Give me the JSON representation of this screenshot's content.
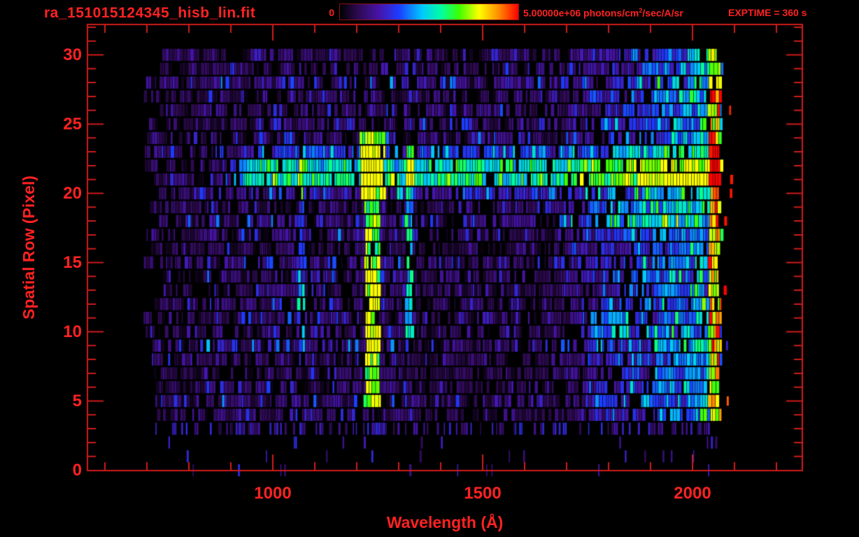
{
  "header": {
    "title": "ra_151015124345_hisb_lin.fit",
    "colorbar": {
      "min_label": "0",
      "max_prefix": "5.00000e+06 photons/cm",
      "max_sup": "2",
      "max_suffix": "/sec/A/sr"
    },
    "exptime": "EXPTIME = 360 s"
  },
  "chart_data": {
    "type": "heatmap",
    "title": "ra_151015124345_hisb_lin.fit",
    "xlabel": "Wavelength (Å)",
    "ylabel": "Spatial Row (Pixel)",
    "x_ticks": [
      1000,
      1500,
      2000
    ],
    "x_minor_step": 100,
    "x_minor_range": [
      600,
      2200
    ],
    "x_range": [
      558,
      2262
    ],
    "y_ticks": [
      0,
      5,
      10,
      15,
      20,
      25,
      30
    ],
    "y_minor_step": 1,
    "y_range": [
      0,
      32.2
    ],
    "colorbar": {
      "min": 0,
      "max": 5000000,
      "max_label": "5.00000e+06",
      "units": "photons/cm^2/sec/A/sr"
    },
    "exposure": "360 s",
    "colors": {
      "text": "#ff2222",
      "line": "#cf1b1b",
      "background": "#000000"
    },
    "colormap_stops": [
      [
        0.0,
        "#000000"
      ],
      [
        0.1,
        "#2d0a50"
      ],
      [
        0.22,
        "#4614a8"
      ],
      [
        0.33,
        "#1d3cff"
      ],
      [
        0.46,
        "#00c8ff"
      ],
      [
        0.57,
        "#00ff9d"
      ],
      [
        0.67,
        "#3fff00"
      ],
      [
        0.78,
        "#ffff00"
      ],
      [
        0.89,
        "#ff8c00"
      ],
      [
        1.0,
        "#ff0000"
      ]
    ],
    "render": {
      "data_wavelength_start": 720,
      "data_wavelength_end": 2070,
      "rows": 31,
      "sparse_rows_below": 4,
      "right_brighten_start": 1680,
      "spectrum_band": {
        "rows": [
          20,
          23
        ],
        "start_wavelength": 905,
        "peak_rows": [
          21,
          22
        ],
        "peak_boost": 0.4
      },
      "emission_lines": [
        {
          "name": "bright-emission-line",
          "wavelength": 1238,
          "halfwidth": 18,
          "row_min": 5,
          "row_max": 24,
          "boost": 0.55
        },
        {
          "name": "cyan-emission-line",
          "wavelength": 1327,
          "halfwidth": 9,
          "row_min": 10,
          "row_max": 23,
          "boost": 0.34
        },
        {
          "name": "faint-emission-line",
          "wavelength": 1068,
          "halfwidth": 7,
          "row_min": 8,
          "row_max": 22,
          "boost": 0.2
        }
      ],
      "right_edge_column": {
        "start": 2040,
        "end": 2068,
        "boost": 0.34
      },
      "patches": [
        {
          "rows": [
            18,
            19
          ],
          "wavelengths": [
            1690,
            2070
          ],
          "boost": 0.12
        },
        {
          "rows": [
            10,
            11
          ],
          "wavelengths": [
            1760,
            1850
          ],
          "boost": 0.18
        },
        {
          "rows": [
            17,
            21
          ],
          "wavelengths": [
            1510,
            1524
          ],
          "boost": 0.15
        }
      ]
    }
  }
}
